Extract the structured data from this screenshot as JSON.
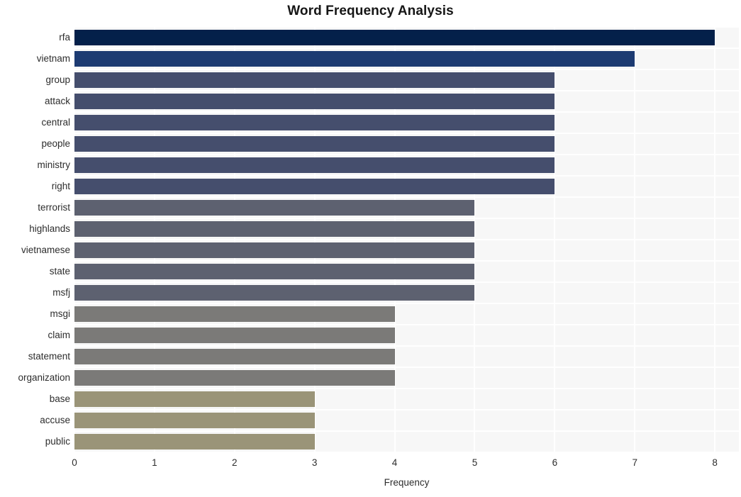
{
  "chart_data": {
    "type": "bar",
    "orientation": "horizontal",
    "title": "Word Frequency Analysis",
    "xlabel": "Frequency",
    "ylabel": "",
    "xlim": [
      0,
      8.3
    ],
    "xticks": [
      0,
      1,
      2,
      3,
      4,
      5,
      6,
      7,
      8
    ],
    "xtick_labels": [
      "0",
      "1",
      "2",
      "3",
      "4",
      "5",
      "6",
      "7",
      "8"
    ],
    "grid": true,
    "legend": null,
    "categories": [
      "rfa",
      "vietnam",
      "group",
      "attack",
      "central",
      "people",
      "ministry",
      "right",
      "terrorist",
      "highlands",
      "vietnamese",
      "state",
      "msfj",
      "msgi",
      "claim",
      "statement",
      "organization",
      "base",
      "accuse",
      "public"
    ],
    "values": [
      8,
      7,
      6,
      6,
      6,
      6,
      6,
      6,
      5,
      5,
      5,
      5,
      5,
      4,
      4,
      4,
      4,
      3,
      3,
      3
    ],
    "bar_colors": [
      "#04204a",
      "#1d3b72",
      "#454e6d",
      "#454e6d",
      "#454e6d",
      "#454e6d",
      "#454e6d",
      "#454e6d",
      "#5d6170",
      "#5d6170",
      "#5d6170",
      "#5d6170",
      "#5d6170",
      "#7b7a78",
      "#7b7a78",
      "#7b7a78",
      "#7b7a78",
      "#9a9478",
      "#9a9478",
      "#9a9478"
    ],
    "plot_background": "#f7f7f7",
    "figure_background": "#ffffff",
    "gridline_color": "#ffffff",
    "text_color": "#2d2d2d",
    "title_color": "#161616"
  }
}
